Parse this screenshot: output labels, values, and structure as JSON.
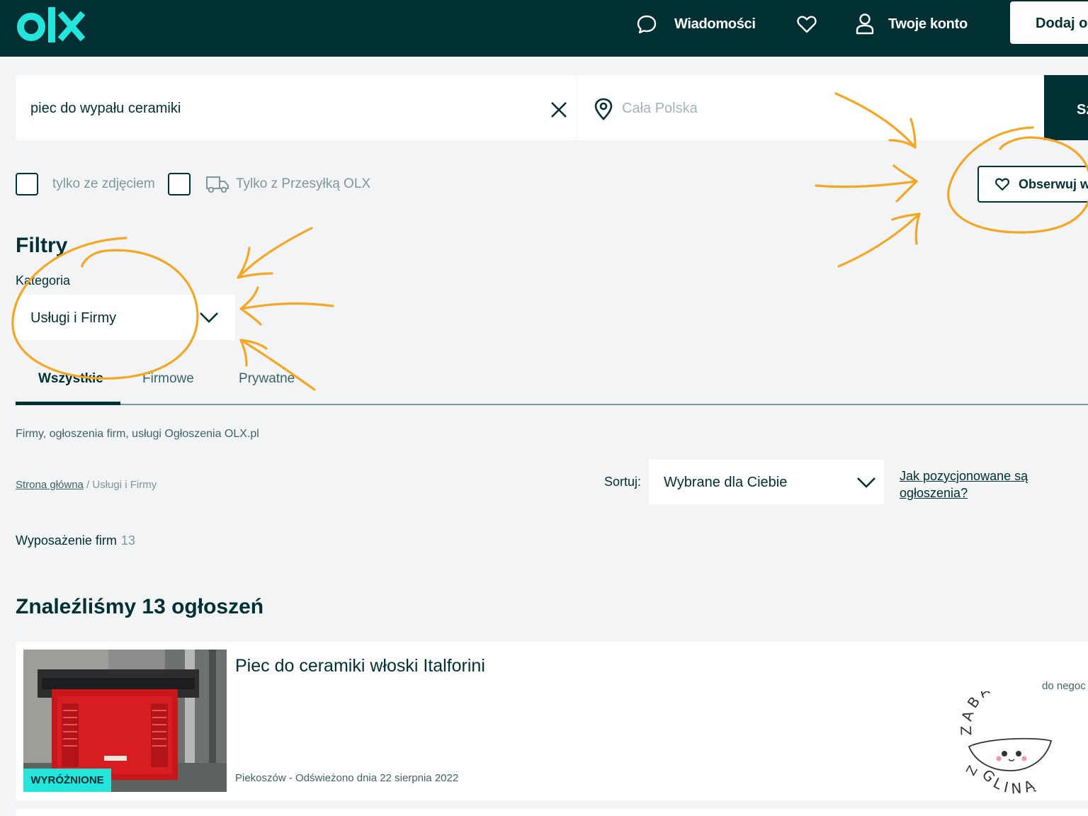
{
  "header": {
    "logo_text": "olx",
    "messages_label": "Wiadomości",
    "account_label": "Twoje konto",
    "add_button_label": "Dodaj o"
  },
  "search": {
    "query": "piec do wypału ceramiki",
    "location_placeholder": "Cała Polska",
    "button_label": "Sz"
  },
  "options": {
    "photos_only_label": "tylko ze zdjęciem",
    "delivery_only_label": "Tylko z Przesyłką OLX",
    "observe_label": "Obserwuj w"
  },
  "filters": {
    "title": "Filtry",
    "category_label": "Kategoria",
    "category_value": "Usługi i Firmy",
    "tabs": [
      {
        "label": "Wszystkie",
        "active": true
      },
      {
        "label": "Firmowe",
        "active": false
      },
      {
        "label": "Prywatne",
        "active": false
      }
    ]
  },
  "seo_text": "Firmy, ogłoszenia firm, usługi Ogłoszenia OLX.pl",
  "breadcrumb": {
    "home": "Strona główna",
    "separator": " / ",
    "current": "Usługi i Firmy"
  },
  "sort": {
    "label": "Sortuj:",
    "value": "Wybrane dla Ciebie",
    "help_link": "Jak pozycjonowane są ogłoszenia?"
  },
  "subcategory": {
    "name": "Wyposażenie firm",
    "count": "13"
  },
  "results_title": "Znaleźliśmy 13 ogłoszeń",
  "listings": [
    {
      "title": "Piec do ceramiki włoski Italforini",
      "badge": "WYRÓŻNIONE",
      "location_date": "Piekoszów - Odświeżono dnia 22 sierpnia 2022",
      "price_note": "do negoc"
    }
  ],
  "watermark": {
    "top_text": "ZABAWY",
    "bottom_text": "GLINĄ",
    "side_text": "Z"
  },
  "colors": {
    "brand_dark": "#002f34",
    "brand_teal": "#23e5db",
    "annotation_orange": "#f5a623"
  }
}
